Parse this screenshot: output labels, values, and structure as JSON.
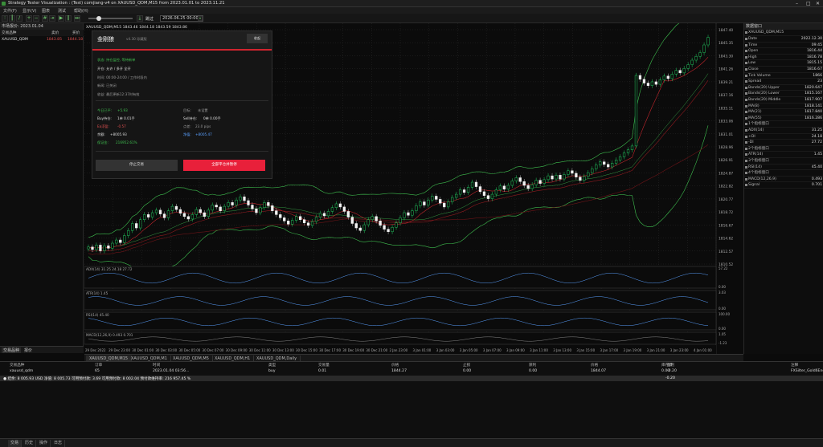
{
  "window": {
    "title": "Strategy Tester Visualization : (Test) comjiang-v4 on XAUUSD_QDM,M15 from 2023.01.01 to 2023.11.21"
  },
  "menu": [
    "文件(F)",
    "显示(V)",
    "图表",
    "测试",
    "帮助(H)"
  ],
  "toolbar": {
    "date_value": "2026.06.25 00:00",
    "skip_label": "跳过"
  },
  "market_watch": {
    "title": "市场报价: 2023.01.04",
    "cols": [
      "交易品种",
      "卖价",
      "买价"
    ],
    "rows": [
      {
        "symbol": "XAUUSD_QDM",
        "bid": "1843.85",
        "ask": "1844.18"
      }
    ],
    "tabs": [
      "交易品种",
      "报价"
    ]
  },
  "chart": {
    "symbol_header": "XAUUSD_QDM,M15  1843.46 1844.18 1843.59 1843.86",
    "price_ticks": [
      "1847.40",
      "1845.35",
      "1843.30",
      "1841.26",
      "1839.21",
      "1837.16",
      "1835.11",
      "1833.06",
      "1831.01",
      "1828.96",
      "1826.91",
      "1824.87",
      "1822.82",
      "1820.77",
      "1818.72",
      "1816.67",
      "1814.62",
      "1812.57",
      "1810.52"
    ],
    "time_ticks": [
      "29 Dec 2022",
      "29 Dec 23:00",
      "30 Dec 01:00",
      "30 Dec 03:00",
      "30 Dec 05:00",
      "30 Dec 07:00",
      "30 Dec 09:00",
      "30 Dec 11:00",
      "30 Dec 13:00",
      "30 Dec 15:00",
      "30 Dec 17:00",
      "30 Dec 19:00",
      "30 Dec 21:00",
      "2 Jan 23:00",
      "3 Jan 01:00",
      "3 Jan 03:00",
      "3 Jan 05:00",
      "3 Jan 07:00",
      "3 Jan 09:00",
      "3 Jan 11:00",
      "3 Jan 13:00",
      "3 Jan 15:00",
      "3 Jan 17:00",
      "3 Jan 19:00",
      "3 Jan 21:00",
      "3 Jan 23:00",
      "4 Jan 01:00"
    ],
    "sub_labels": [
      "ADX(14) 31.25 24.18 27.72",
      "ATR(14) 1.45",
      "RSI(14) 45.40",
      "MACD(12,26,9) 0.493 0.701"
    ],
    "sub_ticks": [
      "57.22",
      "0.00",
      "3.03",
      "0.00",
      "100.00",
      "0.00",
      "1.05",
      "-1.23"
    ]
  },
  "panel": {
    "title": "金刚狼",
    "version": "v4.30 珍藏版",
    "collapse": "收起",
    "status_line": "状态: 持仓监控, 等待新单",
    "switch_line": "开仓: 允许 / 多开 全开",
    "time_line": "时间: 00:00-24:00 / 工作时段内",
    "news_line": "新闻: 已关闭",
    "profit_line": "收益: 最后更新12:37时有效",
    "today_label": "今日已平:",
    "today_value": "+5.93",
    "target_label": "目标:",
    "target_value": "未设置",
    "buy_label": "Buy持仓:",
    "buy_value": "1单  0.01手",
    "sell_label": "Sell持仓:",
    "sell_value": "0单  0.00手",
    "float_label": "Ea浮盈:",
    "float_value": "-0.57",
    "spread_label": "点差:",
    "spread_value": "23.0 pips",
    "balance_label": "余额:",
    "balance_value": "+8005.93",
    "equity_label": "净值:",
    "equity_value": "+8005.47",
    "margin_label": "保证金:",
    "margin_value": "216952.61%",
    "stop_btn": "停止交易",
    "close_btn": "全部平仓并暂停"
  },
  "data_window": {
    "title": "数据窗口",
    "symbol": "XAUUSD_QDM,M15",
    "rows": [
      [
        "Date",
        "2022.12.30"
      ],
      [
        "Time",
        "09:45"
      ],
      [
        "Open",
        "1816.44"
      ],
      [
        "High",
        "1816.78"
      ],
      [
        "Low",
        "1815.15"
      ],
      [
        "Close",
        "1816.67"
      ],
      [
        "Tick Volume",
        "1866"
      ],
      [
        "Spread",
        "23"
      ],
      [
        "Bands(20) Upper",
        "1820.647"
      ],
      [
        "Bands(20) Lower",
        "1815.167"
      ],
      [
        "Bands(20) Middle",
        "1817.907"
      ],
      [
        "MA(8)",
        "1818.141"
      ],
      [
        "MA(21)",
        "1817.840"
      ],
      [
        "MA(55)",
        "1816.286"
      ],
      [
        "1个指标窗口",
        ""
      ],
      [
        "ADX(14)",
        "31.25"
      ],
      [
        "+DI",
        "24.18"
      ],
      [
        "-DI",
        "27.72"
      ],
      [
        "2个指标窗口",
        ""
      ],
      [
        "ATR(14)",
        "1.45"
      ],
      [
        "3个指标窗口",
        ""
      ],
      [
        "RSI(14)",
        "45.40"
      ],
      [
        "4个指标窗口",
        ""
      ],
      [
        "MACD(12,26,9)",
        "0.493"
      ],
      [
        "Signal",
        "0.701"
      ]
    ]
  },
  "chart_tabs": [
    "XAUUSD_QDM,M15",
    "XAUUSD_QDM,M1",
    "XAUUSD_QDM,M5",
    "XAUUSD_QDM,H1",
    "XAUUSD_QDM,Daily"
  ],
  "trade": {
    "headers": [
      "交易品种",
      "订单",
      "时间",
      "类型",
      "交易量",
      "价格",
      "止损",
      "获利",
      "价格",
      "库存费",
      "盈利",
      "注释"
    ],
    "row": [
      "xauusd_qdm",
      "65",
      "2023.01.04 03:56...",
      "buy",
      "0.01",
      "1844.27",
      "0.00",
      "0.00",
      "1844.07",
      "0.00",
      "-0.20",
      "FXSilter_Gold6Eng"
    ],
    "balance_line": "● 结余: 8 005.93 USD  净值: 8 005.73  可用预付款: 3.69  可用预付款: 8 002.04  预付款维持率: 216 957.45 %",
    "balance_profit": "-0.20"
  },
  "status_tabs": [
    "交易",
    "历史",
    "操作",
    "日志"
  ],
  "chart_data": {
    "type": "candlestick",
    "symbol": "XAUUSD_QDM",
    "timeframe": "M15",
    "ylim": [
      1810.52,
      1847.4
    ],
    "closes": [
      1813.2,
      1812.8,
      1813.5,
      1812.6,
      1813.4,
      1813.0,
      1813.8,
      1814.3,
      1813.9,
      1815.0,
      1815.8,
      1816.9,
      1816.2,
      1817.5,
      1818.3,
      1817.9,
      1818.6,
      1819.0,
      1818.4,
      1817.8,
      1818.9,
      1819.6,
      1819.1,
      1818.5,
      1818.0,
      1817.6,
      1818.3,
      1819.1,
      1818.6,
      1818.0,
      1819.0,
      1819.8,
      1819.5,
      1818.9,
      1819.6,
      1820.2,
      1819.8,
      1820.6,
      1821.1,
      1820.5,
      1819.8,
      1819.2,
      1818.6,
      1819.4,
      1820.2,
      1819.7,
      1818.9,
      1818.3,
      1817.8,
      1817.3,
      1816.8,
      1817.4,
      1818.0,
      1817.5,
      1817.0,
      1816.6,
      1817.2,
      1817.9,
      1818.5,
      1818.1,
      1818.8,
      1819.4,
      1820.0,
      1819.5,
      1818.8,
      1817.9,
      1816.9,
      1816.2,
      1815.8,
      1816.7,
      1817.5,
      1818.0,
      1817.3,
      1816.6,
      1816.0,
      1815.6,
      1816.3,
      1817.0,
      1817.8,
      1818.6,
      1818.2,
      1818.9,
      1819.7,
      1820.3,
      1819.8,
      1820.6,
      1821.2,
      1820.7,
      1820.1,
      1819.5,
      1820.3,
      1821.0,
      1821.5,
      1822.2,
      1821.8,
      1822.6,
      1823.4,
      1822.7,
      1821.9,
      1821.3,
      1820.8,
      1821.5,
      1822.2,
      1822.8,
      1822.3,
      1822.9,
      1823.6,
      1824.1,
      1823.5,
      1822.9,
      1822.4,
      1823.0,
      1823.7,
      1823.2,
      1823.8,
      1824.4,
      1823.9,
      1824.5,
      1823.9,
      1824.6,
      1825.2,
      1824.8,
      1824.2,
      1823.7,
      1824.3,
      1824.9,
      1825.5,
      1826.1,
      1826.6,
      1826.2,
      1825.8,
      1826.4,
      1826.9,
      1827.4,
      1828.0,
      1828.5,
      1829.1,
      1840.2,
      1839.6,
      1839.0,
      1838.6,
      1839.2,
      1838.8,
      1839.5,
      1840.1,
      1839.7,
      1840.4,
      1841.0,
      1840.6,
      1841.3,
      1841.9,
      1842.6,
      1843.2,
      1843.8,
      1845.0,
      1846.2
    ]
  },
  "colors": {
    "bull": "#22c55e",
    "bear": "#f2f2f2",
    "bands": "#3fbf4f",
    "ma": "#c0262c",
    "grid": "#2a2a2a",
    "accent": "#e8203a"
  }
}
